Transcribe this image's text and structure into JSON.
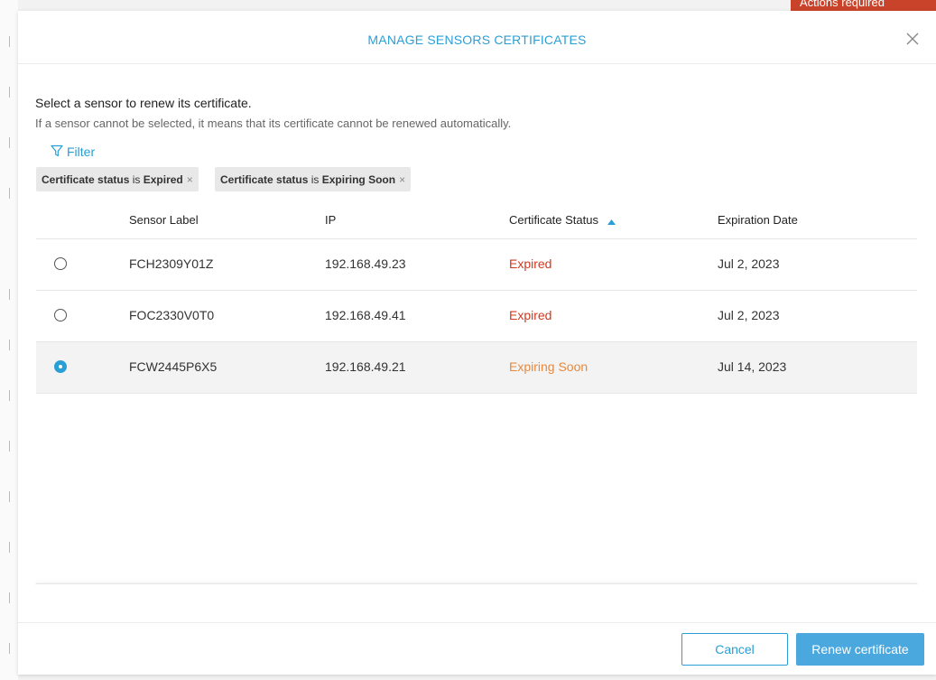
{
  "background": {
    "badge_label": "Actions required"
  },
  "modal": {
    "title": "MANAGE SENSORS CERTIFICATES",
    "instruction": "Select a sensor to renew its certificate.",
    "note": "If a sensor cannot be selected, it means that its certificate cannot be renewed automatically.",
    "filter_label": "Filter",
    "chips": [
      {
        "field": "Certificate status",
        "op": "is",
        "value": "Expired"
      },
      {
        "field": "Certificate status",
        "op": "is",
        "value": "Expiring Soon"
      }
    ]
  },
  "table": {
    "columns": [
      "Sensor Label",
      "IP",
      "Certificate Status",
      "Expiration Date"
    ],
    "rows": [
      {
        "label": "FCH2309Y01Z",
        "ip": "192.168.49.23",
        "status": "Expired",
        "expiration": "Jul 2, 2023",
        "selected": false
      },
      {
        "label": "FOC2330V0T0",
        "ip": "192.168.49.41",
        "status": "Expired",
        "expiration": "Jul 2, 2023",
        "selected": false
      },
      {
        "label": "FCW2445P6X5",
        "ip": "192.168.49.21",
        "status": "Expiring Soon",
        "expiration": "Jul 14, 2023",
        "selected": true
      }
    ]
  },
  "footer": {
    "cancel_label": "Cancel",
    "renew_label": "Renew certificate"
  },
  "colors": {
    "accent": "#2a9fd6",
    "expired": "#d0391f",
    "expiring_soon": "#e8893d"
  },
  "icons": {
    "close": "close-icon",
    "filter": "filter-icon",
    "sort": "sort-asc-icon"
  }
}
